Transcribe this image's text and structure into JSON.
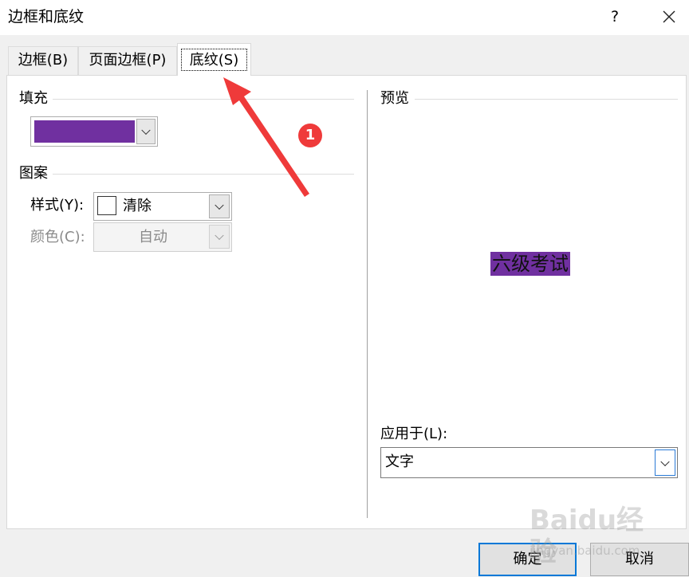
{
  "window": {
    "title": "边框和底纹",
    "help_label": "?",
    "close_icon": "close-icon"
  },
  "tabs": [
    {
      "label": "边框(B)",
      "active": false
    },
    {
      "label": "页面边框(P)",
      "active": false
    },
    {
      "label": "底纹(S)",
      "active": true
    }
  ],
  "fill": {
    "label": "填充",
    "color": "#7030a0"
  },
  "pattern": {
    "label": "图案",
    "style_label": "样式(Y):",
    "style_value": "清除",
    "color_label": "颜色(C):",
    "color_value": "自动"
  },
  "preview": {
    "label": "预览",
    "text": "六级考试",
    "highlight_color": "#7030a0"
  },
  "apply_to": {
    "label": "应用于(L):",
    "value": "文字"
  },
  "buttons": {
    "ok": "确定",
    "cancel": "取消"
  },
  "annotation": {
    "badge": "1",
    "color": "#ef3a3a"
  },
  "watermark": {
    "main": "Baidu经验",
    "sub": "jingyan.baidu.com"
  }
}
